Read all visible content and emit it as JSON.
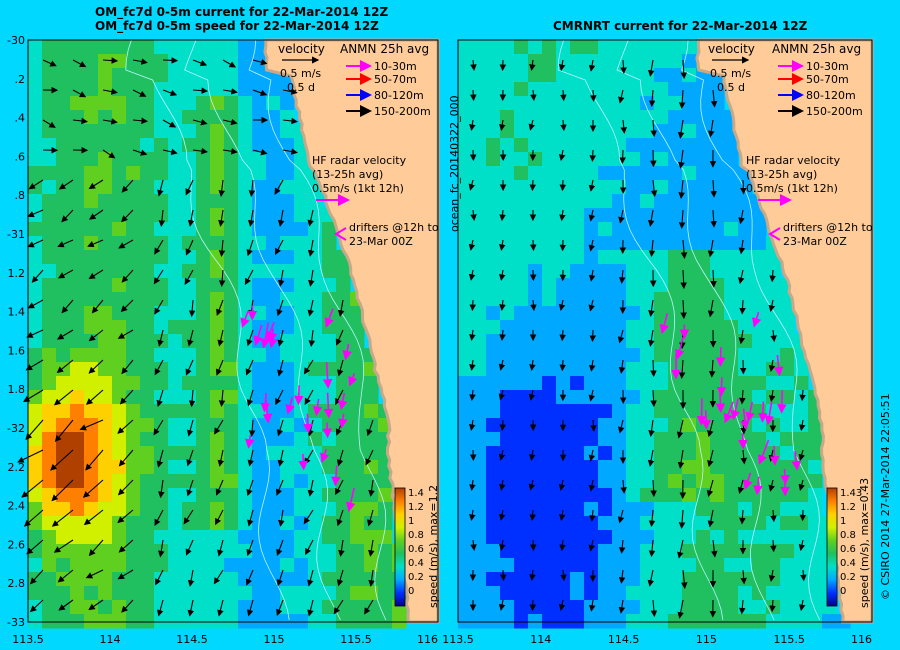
{
  "left_panel": {
    "title_line1": "OM_fc7d 0-5m current for 22-Mar-2014 12Z",
    "title_line2": "OM_fc7d 0-5m speed for 22-Mar-2014 12Z",
    "colorbar_label": "speed (m/s), max=1.2"
  },
  "right_panel": {
    "title": "CMRNRT current for 22-Mar-2014 12Z",
    "colorbar_label": "speed (m/s), max=0.43",
    "side_label": "ocean_fc_20140322_000"
  },
  "legend": {
    "velocity": "velocity",
    "scale_speed": "0.5 m/s",
    "scale_time": "0.5 d",
    "anmn_title": "ANMN 25h avg",
    "depths": [
      {
        "label": "10-30m",
        "color": "#ff00ff"
      },
      {
        "label": "50-70m",
        "color": "#ff0000"
      },
      {
        "label": "80-120m",
        "color": "#0000ff"
      },
      {
        "label": "150-200m",
        "color": "#000000"
      }
    ],
    "hf_line1": "HF radar velocity",
    "hf_line2": "(13-25h avg)",
    "hf_line3": "0.5m/s (1kt 12h)",
    "drifters_line1": "drifters @12h to",
    "drifters_line2": "23-Mar 00Z"
  },
  "axes": {
    "lat_ticks": [
      "-30",
      ".2",
      ".4",
      ".6",
      ".8",
      "-31",
      "1.2",
      "1.4",
      "1.6",
      "1.8",
      "-32",
      "2.2",
      "2.4",
      "2.6",
      "2.8",
      "-33"
    ],
    "lon_ticks": [
      "113.5",
      "114",
      "114.5",
      "115",
      "115.5",
      "116"
    ],
    "lon_ticks_right": [
      "113.5",
      "114",
      "114.5",
      "115",
      "115.5",
      "116"
    ],
    "lon_range": [
      113.5,
      116
    ],
    "lat_range": [
      -30,
      -33
    ]
  },
  "colorbar": {
    "left_ticks": [
      "1.4",
      "1.2",
      "1",
      "0.8",
      "0.6",
      "0.4",
      "0.2",
      "0"
    ],
    "right_ticks": [
      "1.43",
      "1.2",
      "1",
      "0.8",
      "0.6",
      "0.4",
      "0.2",
      "0"
    ],
    "stops": [
      "#00008a",
      "#0030ff",
      "#00a8ff",
      "#00e0c8",
      "#20c060",
      "#60d020",
      "#d0f000",
      "#ffd000",
      "#ff8000",
      "#b04000"
    ]
  },
  "credit": "© CSIRO 2014   27-Mar-2014 22:05:51",
  "colors": {
    "background": "#00d8ff",
    "land": "#ffcc99",
    "coast_shelf": "#c8a888",
    "hf_arrow": "#ff00ff"
  }
}
